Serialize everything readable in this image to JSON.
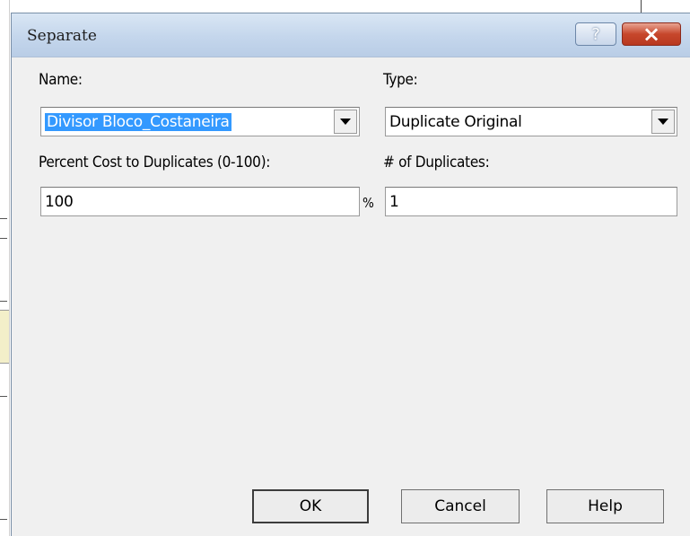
{
  "dialog": {
    "title": "Separate",
    "help_glyph": "?",
    "close_glyph": "×"
  },
  "form": {
    "name_label": "Name:",
    "name_value": "Divisor Bloco_Costaneira",
    "type_label": "Type:",
    "type_value": "Duplicate Original",
    "percent_label": "Percent Cost to Duplicates (0-100):",
    "percent_value": "100",
    "percent_unit": "%",
    "duplicates_label": "# of Duplicates:",
    "duplicates_value": "1"
  },
  "buttons": {
    "ok": "OK",
    "cancel": "Cancel",
    "help": "Help"
  }
}
